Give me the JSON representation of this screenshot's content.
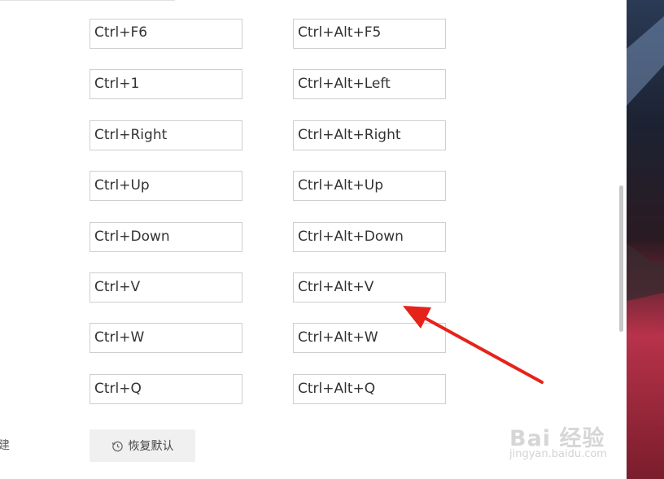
{
  "shortcuts": {
    "left": [
      "Ctrl+F6",
      "Ctrl+1",
      "Ctrl+Right",
      "Ctrl+Up",
      "Ctrl+Down",
      "Ctrl+V",
      "Ctrl+W",
      "Ctrl+Q"
    ],
    "right": [
      "Ctrl+Alt+F5",
      "Ctrl+Alt+Left",
      "Ctrl+Alt+Right",
      "Ctrl+Alt+Up",
      "Ctrl+Alt+Down",
      "Ctrl+Alt+V",
      "Ctrl+Alt+W",
      "Ctrl+Alt+Q"
    ]
  },
  "left_label": "建",
  "restore_button": {
    "label": "恢复默认",
    "icon": "clock-restore-icon"
  },
  "annotation": {
    "color": "#e5231b"
  },
  "watermark": {
    "text": "Bai 经验",
    "sub": "jingyan.baidu.com"
  }
}
